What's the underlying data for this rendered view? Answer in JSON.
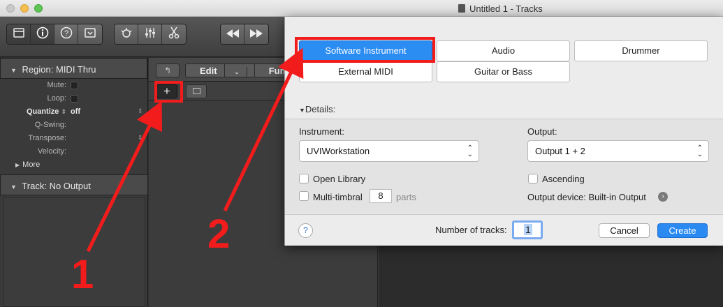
{
  "window": {
    "title": "Untitled 1 - Tracks"
  },
  "toolbar": {
    "left_icons": [
      "library-icon",
      "info-icon",
      "help-icon",
      "toolbar-toggle-icon"
    ],
    "mid_icons": [
      "smart-controls-icon",
      "mixer-icon",
      "scissors-icon"
    ],
    "transport_icons": [
      "rewind-icon",
      "fast-forward-icon"
    ]
  },
  "inspector": {
    "region_label": "Region:",
    "region_name": "MIDI Thru",
    "fields": {
      "mute": "Mute:",
      "loop": "Loop:",
      "quantize": "Quantize",
      "quantize_value": "off",
      "qswing": "Q-Swing:",
      "transpose": "Transpose:",
      "velocity": "Velocity:"
    },
    "more": "More",
    "track_label": "Track:",
    "track_value": "No Output"
  },
  "tracks": {
    "menus": [
      "Edit",
      "Functions"
    ],
    "add_button": "+"
  },
  "dialog": {
    "types": {
      "software_instrument": "Software Instrument",
      "audio": "Audio",
      "drummer": "Drummer",
      "external_midi": "External MIDI",
      "guitar_bass": "Guitar or Bass"
    },
    "details_label": "Details:",
    "instrument_label": "Instrument:",
    "instrument_value": "UVIWorkstation",
    "output_label": "Output:",
    "output_value": "Output 1 + 2",
    "open_library": "Open Library",
    "multi_timbral": "Multi-timbral",
    "parts_value": "8",
    "parts_label": "parts",
    "ascending": "Ascending",
    "output_device": "Output device: Built-in Output",
    "help": "?",
    "number_of_tracks_label": "Number of tracks:",
    "number_of_tracks_value": "1",
    "cancel": "Cancel",
    "create": "Create"
  },
  "annotations": {
    "step1": "1",
    "step2": "2",
    "color": "#f21c1c"
  }
}
